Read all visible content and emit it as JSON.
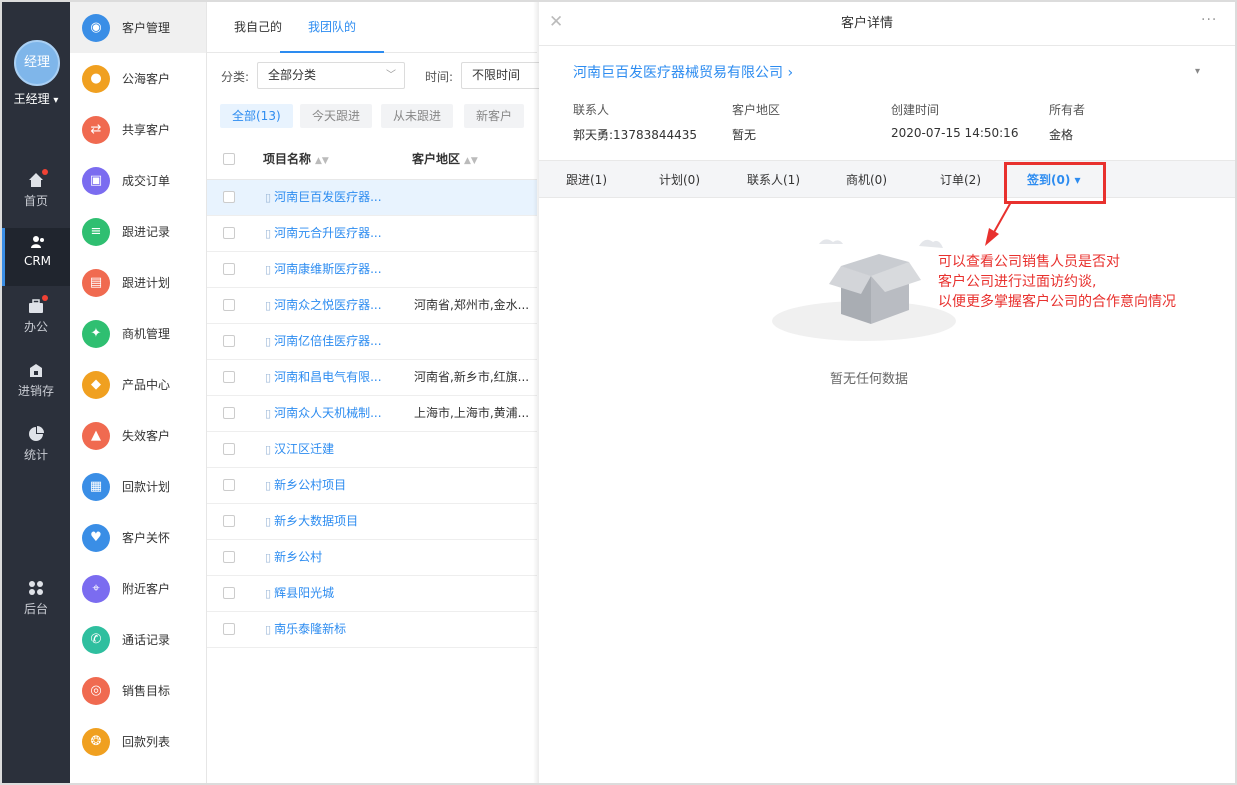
{
  "nav": {
    "avatar_text": "经理",
    "username": "王经理",
    "username_caret": "▾",
    "items": [
      {
        "label": "首页",
        "icon": "home-icon"
      },
      {
        "label": "CRM",
        "icon": "crm-icon"
      },
      {
        "label": "办公",
        "icon": "briefcase-icon"
      },
      {
        "label": "进销存",
        "icon": "warehouse-icon"
      },
      {
        "label": "统计",
        "icon": "pie-chart-icon"
      },
      {
        "label": "后台",
        "icon": "grid-icon"
      }
    ]
  },
  "menu": {
    "items": [
      {
        "label": "客户管理",
        "color": "#3a8ee6"
      },
      {
        "label": "公海客户",
        "color": "#f0a020"
      },
      {
        "label": "共享客户",
        "color": "#f06a50"
      },
      {
        "label": "成交订单",
        "color": "#7b6cf0"
      },
      {
        "label": "跟进记录",
        "color": "#2fbf71"
      },
      {
        "label": "跟进计划",
        "color": "#f06a50"
      },
      {
        "label": "商机管理",
        "color": "#2fbf71"
      },
      {
        "label": "产品中心",
        "color": "#f0a020"
      },
      {
        "label": "失效客户",
        "color": "#f06a50"
      },
      {
        "label": "回款计划",
        "color": "#3a8ee6"
      },
      {
        "label": "客户关怀",
        "color": "#3a8ee6"
      },
      {
        "label": "附近客户",
        "color": "#7b6cf0"
      },
      {
        "label": "通话记录",
        "color": "#2fbf9f"
      },
      {
        "label": "销售目标",
        "color": "#f06a50"
      },
      {
        "label": "回款列表",
        "color": "#f0a020"
      }
    ]
  },
  "list": {
    "tabs": [
      "我自己的",
      "我团队的"
    ],
    "filter_category_label": "分类:",
    "filter_category_value": "全部分类",
    "filter_time_label": "时间:",
    "filter_time_value": "不限时间",
    "chips": [
      "全部(13)",
      "今天跟进",
      "从未跟进",
      "新客户"
    ],
    "columns": [
      "项目名称",
      "客户地区"
    ],
    "rows": [
      {
        "name": "河南巨百发医疗器...",
        "region": ""
      },
      {
        "name": "河南元合升医疗器...",
        "region": ""
      },
      {
        "name": "河南康维斯医疗器...",
        "region": ""
      },
      {
        "name": "河南众之悦医疗器...",
        "region": "河南省,郑州市,金水..."
      },
      {
        "name": "河南亿倍佳医疗器...",
        "region": ""
      },
      {
        "name": "河南和昌电气有限...",
        "region": "河南省,新乡市,红旗..."
      },
      {
        "name": "河南众人天机械制...",
        "region": "上海市,上海市,黄浦..."
      },
      {
        "name": "汉江区迁建",
        "region": ""
      },
      {
        "name": "新乡公村项目",
        "region": ""
      },
      {
        "name": "新乡大数据项目",
        "region": ""
      },
      {
        "name": "新乡公村",
        "region": ""
      },
      {
        "name": "辉县阳光城",
        "region": ""
      },
      {
        "name": "南乐泰隆新标",
        "region": ""
      }
    ]
  },
  "detail": {
    "title": "客户详情",
    "close_glyph": "✕",
    "more_glyph": "···",
    "company": "河南巨百发医疗器械贸易有限公司 ›",
    "dropdown_caret": "▾",
    "info": [
      {
        "label": "联系人",
        "value": "郭天勇:13783844435"
      },
      {
        "label": "客户地区",
        "value": "暂无"
      },
      {
        "label": "创建时间",
        "value": "2020-07-15 14:50:16"
      },
      {
        "label": "所有者",
        "value": "金格"
      }
    ],
    "tabs": [
      "跟进(1)",
      "计划(0)",
      "联系人(1)",
      "商机(0)",
      "订单(2)",
      "签到(0) ▾"
    ],
    "empty_text": "暂无任何数据",
    "annotation": [
      "可以查看公司销售人员是否对",
      "客户公司进行过面访约谈,",
      "以便更多掌握客户公司的合作意向情况"
    ],
    "accent_color": "#2d8cf0",
    "annotation_color": "#e8312e"
  }
}
